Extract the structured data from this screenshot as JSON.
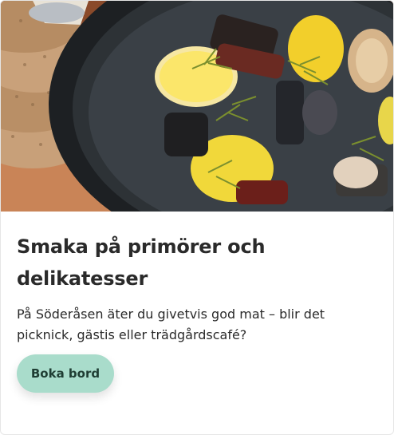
{
  "card": {
    "title": "Smaka på primörer och delikatesser",
    "description": "På Söderåsen äter du givetvis god mat – blir det picknick, gästis eller trädgårdscafé?",
    "button_label": "Boka bord"
  },
  "colors": {
    "button_bg": "#a9dccb",
    "button_text": "#1f3d33",
    "text": "#2a2a2a"
  }
}
